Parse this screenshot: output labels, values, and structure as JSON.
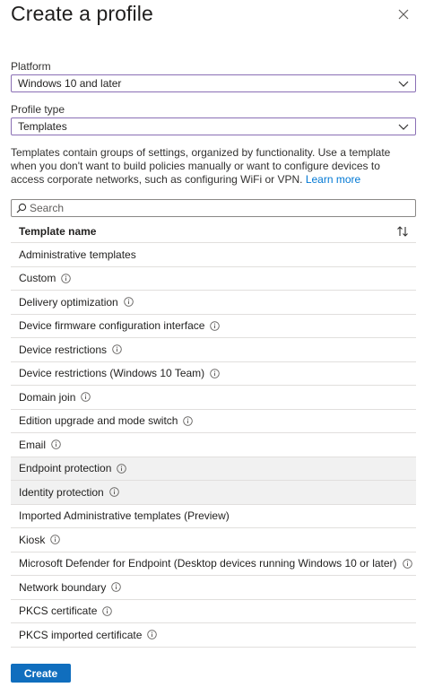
{
  "title": "Create a profile",
  "platform": {
    "label": "Platform",
    "value": "Windows 10 and later"
  },
  "profile_type": {
    "label": "Profile type",
    "value": "Templates"
  },
  "description": {
    "text": "Templates contain groups of settings, organized by functionality. Use a template when you don't want to build policies manually or want to configure devices to access corporate networks, such as configuring WiFi or VPN.",
    "link": "Learn more"
  },
  "search": {
    "placeholder": "Search"
  },
  "table": {
    "header": "Template name",
    "rows": [
      {
        "name": "Administrative templates",
        "info": false,
        "highlighted": false
      },
      {
        "name": "Custom",
        "info": true,
        "highlighted": false
      },
      {
        "name": "Delivery optimization",
        "info": true,
        "highlighted": false
      },
      {
        "name": "Device firmware configuration interface",
        "info": true,
        "highlighted": false
      },
      {
        "name": "Device restrictions",
        "info": true,
        "highlighted": false
      },
      {
        "name": "Device restrictions (Windows 10 Team)",
        "info": true,
        "highlighted": false
      },
      {
        "name": "Domain join",
        "info": true,
        "highlighted": false
      },
      {
        "name": "Edition upgrade and mode switch",
        "info": true,
        "highlighted": false
      },
      {
        "name": "Email",
        "info": true,
        "highlighted": false
      },
      {
        "name": "Endpoint protection",
        "info": true,
        "highlighted": true
      },
      {
        "name": "Identity protection",
        "info": true,
        "highlighted": true
      },
      {
        "name": "Imported Administrative templates (Preview)",
        "info": false,
        "highlighted": false
      },
      {
        "name": "Kiosk",
        "info": true,
        "highlighted": false
      },
      {
        "name": "Microsoft Defender for Endpoint (Desktop devices running Windows 10 or later)",
        "info": true,
        "highlighted": false
      },
      {
        "name": "Network boundary",
        "info": true,
        "highlighted": false
      },
      {
        "name": "PKCS certificate",
        "info": true,
        "highlighted": false
      },
      {
        "name": "PKCS imported certificate",
        "info": true,
        "highlighted": false
      }
    ]
  },
  "create_label": "Create",
  "colors": {
    "accent": "#106ebe",
    "link": "#0078d4",
    "select_border": "#8a6fb5"
  },
  "icons": {
    "close": "close-icon",
    "chevron": "chevron-down-icon",
    "search": "search-icon",
    "sort": "sort-icon",
    "info": "info-icon"
  }
}
